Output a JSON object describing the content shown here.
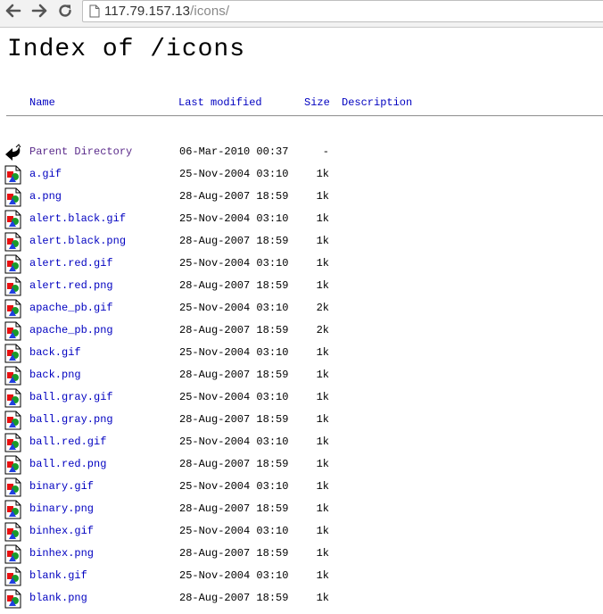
{
  "browser": {
    "url_host": "117.79.157.13",
    "url_path": "/icons/"
  },
  "page": {
    "title": "Index of /icons",
    "columns": {
      "name": "Name",
      "modified": "Last modified",
      "size": "Size",
      "description": "Description"
    },
    "parent": {
      "name": "Parent Directory",
      "modified": "06-Mar-2010 00:37",
      "size": "-",
      "icon": "back-arrow-icon"
    },
    "entries": [
      {
        "name": "a.gif",
        "modified": "25-Nov-2004 03:10",
        "size": "1k"
      },
      {
        "name": "a.png",
        "modified": "28-Aug-2007 18:59",
        "size": "1k"
      },
      {
        "name": "alert.black.gif",
        "modified": "25-Nov-2004 03:10",
        "size": "1k"
      },
      {
        "name": "alert.black.png",
        "modified": "28-Aug-2007 18:59",
        "size": "1k"
      },
      {
        "name": "alert.red.gif",
        "modified": "25-Nov-2004 03:10",
        "size": "1k"
      },
      {
        "name": "alert.red.png",
        "modified": "28-Aug-2007 18:59",
        "size": "1k"
      },
      {
        "name": "apache_pb.gif",
        "modified": "25-Nov-2004 03:10",
        "size": "2k"
      },
      {
        "name": "apache_pb.png",
        "modified": "28-Aug-2007 18:59",
        "size": "2k"
      },
      {
        "name": "back.gif",
        "modified": "25-Nov-2004 03:10",
        "size": "1k"
      },
      {
        "name": "back.png",
        "modified": "28-Aug-2007 18:59",
        "size": "1k"
      },
      {
        "name": "ball.gray.gif",
        "modified": "25-Nov-2004 03:10",
        "size": "1k"
      },
      {
        "name": "ball.gray.png",
        "modified": "28-Aug-2007 18:59",
        "size": "1k"
      },
      {
        "name": "ball.red.gif",
        "modified": "25-Nov-2004 03:10",
        "size": "1k"
      },
      {
        "name": "ball.red.png",
        "modified": "28-Aug-2007 18:59",
        "size": "1k"
      },
      {
        "name": "binary.gif",
        "modified": "25-Nov-2004 03:10",
        "size": "1k"
      },
      {
        "name": "binary.png",
        "modified": "28-Aug-2007 18:59",
        "size": "1k"
      },
      {
        "name": "binhex.gif",
        "modified": "25-Nov-2004 03:10",
        "size": "1k"
      },
      {
        "name": "binhex.png",
        "modified": "28-Aug-2007 18:59",
        "size": "1k"
      },
      {
        "name": "blank.gif",
        "modified": "25-Nov-2004 03:10",
        "size": "1k"
      },
      {
        "name": "blank.png",
        "modified": "28-Aug-2007 18:59",
        "size": "1k"
      }
    ],
    "entry_icon": "image-file-icon",
    "link_color": "#0000c0",
    "visited_color": "#5a2a8a"
  }
}
